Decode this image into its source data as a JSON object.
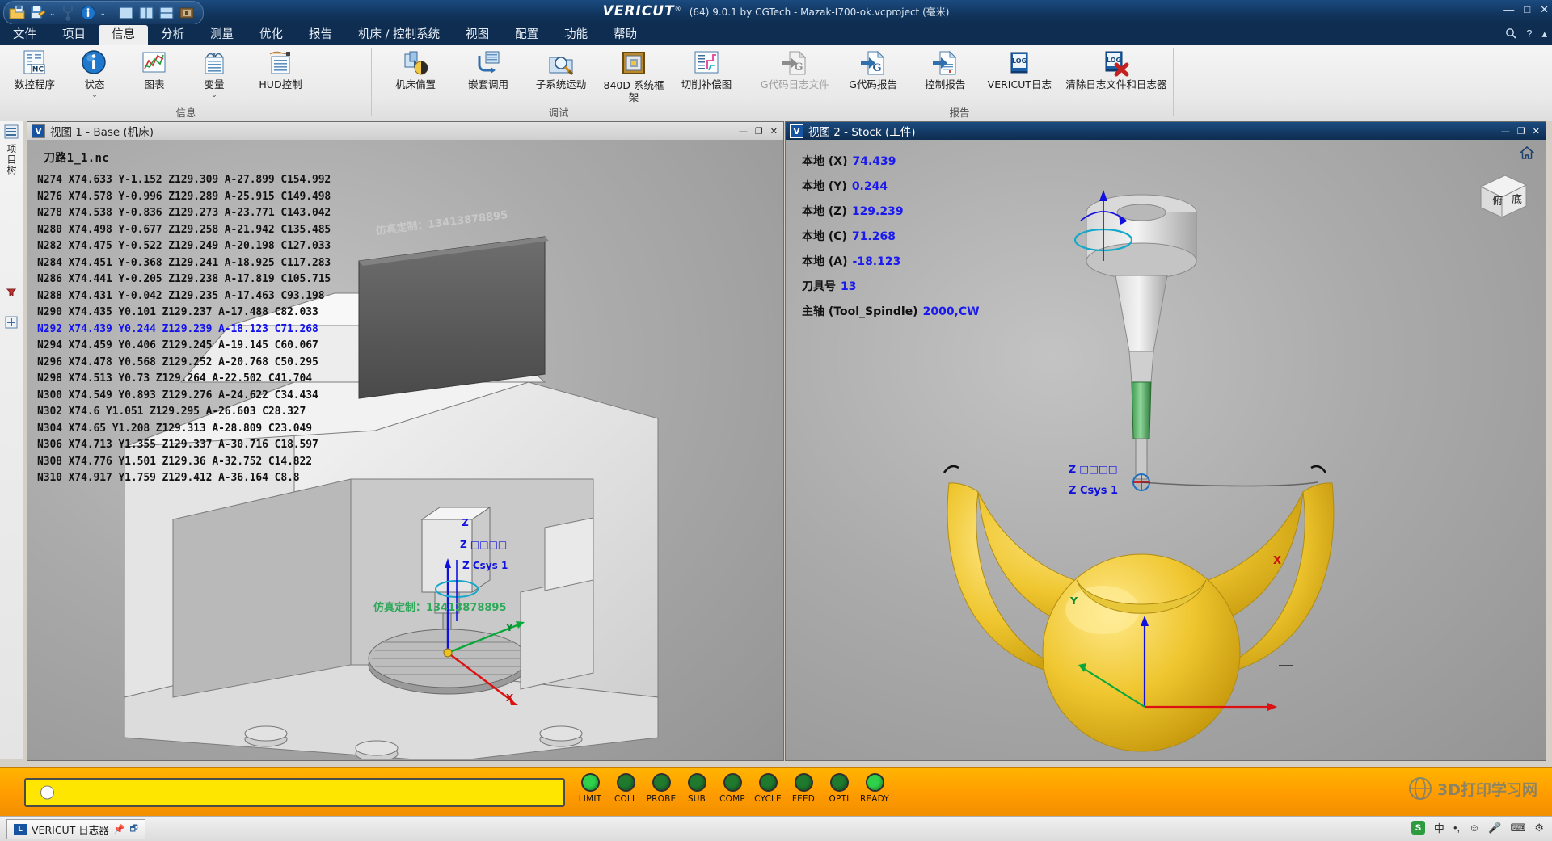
{
  "titlebar": {
    "brand": "VERICUT",
    "brand_sup": "®",
    "version_text": "(64)  9.0.1 by CGTech - Mazak-I700-ok.vcproject (毫米)",
    "quick_access": [
      {
        "name": "open-project-icon",
        "label": "打开"
      },
      {
        "name": "save-project-icon",
        "label": "保存"
      },
      {
        "name": "chevron-down-icon",
        "label": "▾"
      },
      {
        "name": "tool-manager-icon",
        "label": "刀具管理"
      },
      {
        "name": "info-icon",
        "label": "信息"
      },
      {
        "name": "chevron-down-icon-2",
        "label": "▾"
      },
      {
        "name": "single-view-icon",
        "label": "单视图"
      },
      {
        "name": "two-column-view-icon",
        "label": "双列视图"
      },
      {
        "name": "two-row-view-icon",
        "label": "双行视图"
      },
      {
        "name": "machine-view-icon",
        "label": "机床视图"
      }
    ],
    "window_buttons": [
      "—",
      "□",
      "✕"
    ]
  },
  "menubar": {
    "items": [
      {
        "label": "文件",
        "active": false
      },
      {
        "label": "项目",
        "active": false
      },
      {
        "label": "信息",
        "active": true
      },
      {
        "label": "分析",
        "active": false
      },
      {
        "label": "测量",
        "active": false
      },
      {
        "label": "优化",
        "active": false
      },
      {
        "label": "报告",
        "active": false
      },
      {
        "label": "机床 / 控制系统",
        "active": false
      },
      {
        "label": "视图",
        "active": false
      },
      {
        "label": "配置",
        "active": false
      },
      {
        "label": "功能",
        "active": false
      },
      {
        "label": "帮助",
        "active": false
      }
    ],
    "right_icons": [
      {
        "name": "search-icon",
        "glyph": "🔍"
      },
      {
        "name": "help-icon",
        "glyph": "?"
      },
      {
        "name": "ribbon-collapse-icon",
        "glyph": "▴"
      }
    ]
  },
  "ribbon": {
    "groups": [
      {
        "label": "信息",
        "items": [
          {
            "name": "nc-program-button",
            "label": "数控程序",
            "icon": "nc-program-icon",
            "dropdown": false,
            "disabled": false
          },
          {
            "name": "status-button",
            "label": "状态",
            "icon": "status-info-icon",
            "dropdown": true,
            "disabled": false
          },
          {
            "name": "chart-button",
            "label": "图表",
            "icon": "chart-icon",
            "dropdown": false,
            "disabled": false
          },
          {
            "name": "variables-button",
            "label": "变量",
            "icon": "variables-icon",
            "dropdown": true,
            "disabled": false
          },
          {
            "name": "hud-control-button",
            "label": "HUD控制",
            "icon": "hud-control-icon",
            "dropdown": false,
            "disabled": false
          }
        ]
      },
      {
        "label": "调试",
        "items": [
          {
            "name": "machine-offset-button",
            "label": "机床偏置",
            "icon": "machine-offset-icon",
            "dropdown": false,
            "disabled": false
          },
          {
            "name": "nested-call-button",
            "label": "嵌套调用",
            "icon": "nested-call-icon",
            "dropdown": false,
            "disabled": false
          },
          {
            "name": "subsystem-motion-button",
            "label": "子系统运动",
            "icon": "subsystem-motion-icon",
            "dropdown": false,
            "disabled": false
          },
          {
            "name": "840d-framework-button",
            "label": "840D 系统框架",
            "icon": "system-frame-icon",
            "dropdown": false,
            "disabled": false
          },
          {
            "name": "cutter-comp-button",
            "label": "切削补偿图",
            "icon": "cutter-comp-icon",
            "dropdown": false,
            "disabled": false
          }
        ]
      },
      {
        "label": "报告",
        "items": [
          {
            "name": "gcode-log-file-button",
            "label": "G代码日志文件",
            "icon": "gcode-log-file-icon",
            "dropdown": false,
            "disabled": true
          },
          {
            "name": "gcode-report-button",
            "label": "G代码报告",
            "icon": "gcode-report-icon",
            "dropdown": false,
            "disabled": false
          },
          {
            "name": "control-report-button",
            "label": "控制报告",
            "icon": "control-report-icon",
            "dropdown": false,
            "disabled": false
          },
          {
            "name": "vericut-log-button",
            "label": "VERICUT日志",
            "icon": "log-book-icon",
            "dropdown": false,
            "disabled": false
          },
          {
            "name": "clear-log-button",
            "label": "清除日志文件和日志器",
            "icon": "clear-log-icon",
            "dropdown": false,
            "disabled": false
          }
        ]
      }
    ]
  },
  "leftrail": {
    "label": "项目树",
    "buttons": [
      {
        "name": "project-tree-pin-icon",
        "glyph": "📌"
      },
      {
        "name": "project-tree-expand-icon",
        "glyph": "⊞"
      }
    ]
  },
  "view1": {
    "title": "视图 1 - Base (机床)",
    "window_buttons": [
      "—",
      "❐",
      "✕"
    ],
    "nc_file": "刀路1_1.nc",
    "current_line_index": 9,
    "nc_lines": [
      "N274 X74.633 Y-1.152 Z129.309 A-27.899 C154.992",
      "N276 X74.578 Y-0.996 Z129.289 A-25.915 C149.498",
      "N278 X74.538 Y-0.836 Z129.273 A-23.771 C143.042",
      "N280 X74.498 Y-0.677 Z129.258 A-21.942 C135.485",
      "N282 X74.475 Y-0.522 Z129.249 A-20.198 C127.033",
      "N284 X74.451 Y-0.368 Z129.241 A-18.925 C117.283",
      "N286 X74.441 Y-0.205 Z129.238 A-17.819 C105.715",
      "N288 X74.431 Y-0.042 Z129.235 A-17.463 C93.198",
      "N290 X74.435 Y0.101 Z129.237 A-17.488 C82.033",
      "N292 X74.439 Y0.244 Z129.239 A-18.123 C71.268",
      "N294 X74.459 Y0.406 Z129.245 A-19.145 C60.067",
      "N296 X74.478 Y0.568 Z129.252 A-20.768 C50.295",
      "N298 X74.513 Y0.73 Z129.264 A-22.502 C41.704",
      "N300 X74.549 Y0.893 Z129.276 A-24.622 C34.434",
      "N302 X74.6 Y1.051 Z129.295 A-26.603 C28.327",
      "N304 X74.65 Y1.208 Z129.313 A-28.809 C23.049",
      "N306 X74.713 Y1.355 Z129.337 A-30.716 C18.597",
      "N308 X74.776 Y1.501 Z129.36 A-32.752 C14.822",
      "N310 X74.917 Y1.759 Z129.412 A-36.164 C8.8"
    ],
    "csys_label_top": "Z Csys 1",
    "axis_labels": [
      "Z",
      "Y",
      "X"
    ],
    "watermark": "仿真定制：13413878895"
  },
  "view2": {
    "title": "视图 2 - Stock (工件)",
    "window_buttons": [
      "—",
      "❐",
      "✕"
    ],
    "home_icon": "home-icon",
    "orient_cube_text": "俯底",
    "hud": [
      {
        "name": "local-x-readout",
        "label": "本地 (X)",
        "value": "74.439"
      },
      {
        "name": "local-y-readout",
        "label": "本地 (Y)",
        "value": "0.244"
      },
      {
        "name": "local-z-readout",
        "label": "本地 (Z)",
        "value": "129.239"
      },
      {
        "name": "local-c-readout",
        "label": "本地 (C)",
        "value": "71.268"
      },
      {
        "name": "local-a-readout",
        "label": "本地 (A)",
        "value": "-18.123"
      },
      {
        "name": "tool-number-readout",
        "label": "刀具号",
        "value": "13"
      },
      {
        "name": "spindle-readout",
        "label": "主轴 (Tool_Spindle)",
        "value": "2000,CW"
      }
    ],
    "csys_label": "Z Csys 1",
    "axis_labels": [
      "Z",
      "Y",
      "X"
    ]
  },
  "statusbar": {
    "progress_percent": 3,
    "lamps": [
      {
        "name": "limit-lamp",
        "label": "LIMIT",
        "color": "#2fd14a"
      },
      {
        "name": "coll-lamp",
        "label": "COLL",
        "color": "#1f7a2e"
      },
      {
        "name": "probe-lamp",
        "label": "PROBE",
        "color": "#1f7a2e"
      },
      {
        "name": "sub-lamp",
        "label": "SUB",
        "color": "#1f7a2e"
      },
      {
        "name": "comp-lamp",
        "label": "COMP",
        "color": "#1f7a2e"
      },
      {
        "name": "cycle-lamp",
        "label": "CYCLE",
        "color": "#1f7a2e"
      },
      {
        "name": "feed-lamp",
        "label": "FEED",
        "color": "#1f7a2e"
      },
      {
        "name": "opti-lamp",
        "label": "OPTI",
        "color": "#1f7a2e"
      },
      {
        "name": "ready-lamp",
        "label": "READY",
        "color": "#2fd14a"
      }
    ],
    "watermark": "3D打印学习网"
  },
  "taskbar": {
    "item_label": "VERICUT 日志器",
    "item_icon": "log-icon",
    "pin_icons": [
      "📌",
      "🗗"
    ],
    "tray": [
      "中",
      "•,",
      "☺",
      "🎤",
      "⌨",
      "⚙"
    ]
  },
  "colors": {
    "accent_blue": "#1a1aee",
    "title_blue": "#0e2d50",
    "status_orange": "#ff9b00",
    "progress_yellow": "#ffe600",
    "stock_gold": "#e8c23a"
  }
}
